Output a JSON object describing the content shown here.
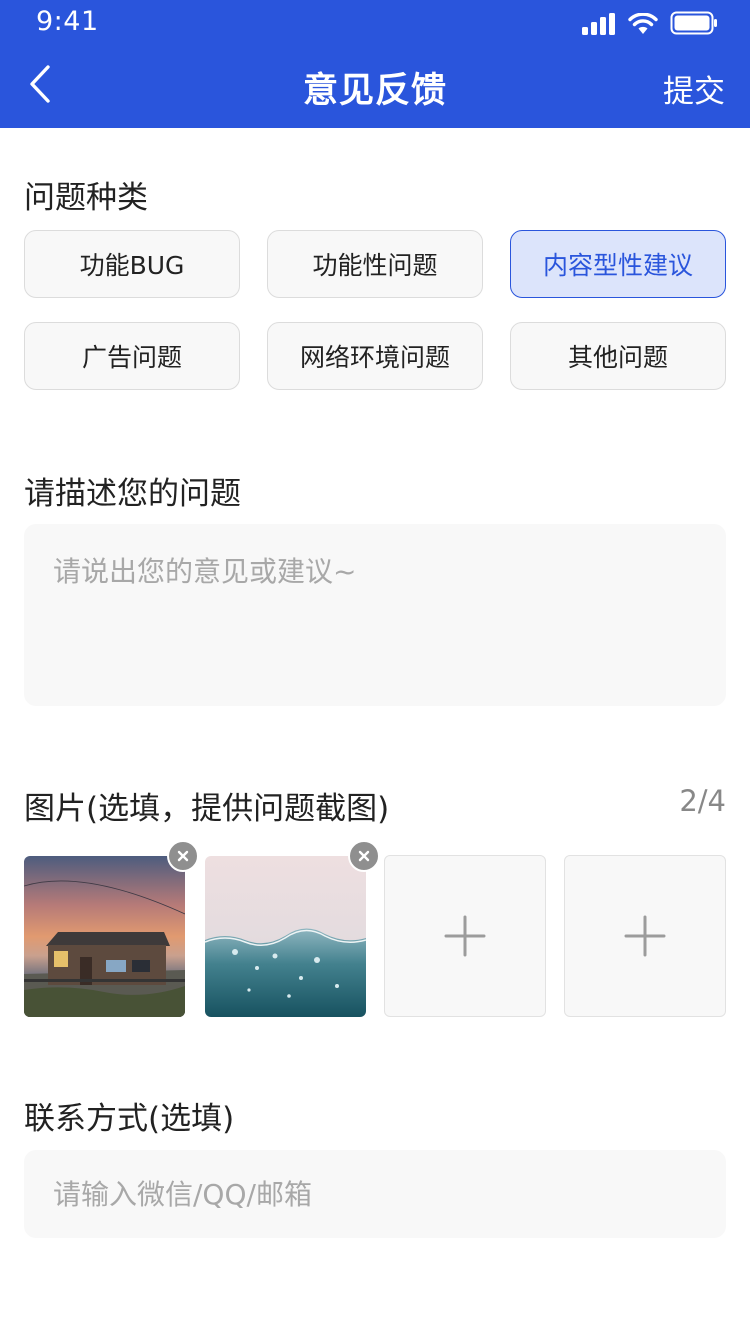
{
  "status_bar": {
    "time": "9:41"
  },
  "nav": {
    "title": "意见反馈",
    "submit_label": "提交"
  },
  "category": {
    "title": "问题种类",
    "options": [
      {
        "label": "功能BUG",
        "selected": false
      },
      {
        "label": "功能性问题",
        "selected": false
      },
      {
        "label": "内容型性建议",
        "selected": true
      },
      {
        "label": "广告问题",
        "selected": false
      },
      {
        "label": "网络环境问题",
        "selected": false
      },
      {
        "label": "其他问题",
        "selected": false
      }
    ]
  },
  "description": {
    "title": "请描述您的问题",
    "placeholder": "请说出您的意见或建议~",
    "value": ""
  },
  "images": {
    "title": "图片(选填，提供问题截图)",
    "count": "2/4"
  },
  "contact": {
    "title": "联系方式(选填)",
    "placeholder": "请输入微信/QQ/邮箱",
    "value": ""
  },
  "colors": {
    "brand": "#2a55dc",
    "selected_bg": "#dce4fb",
    "field_bg": "#f8f8f8",
    "placeholder": "#a8a8a8"
  }
}
